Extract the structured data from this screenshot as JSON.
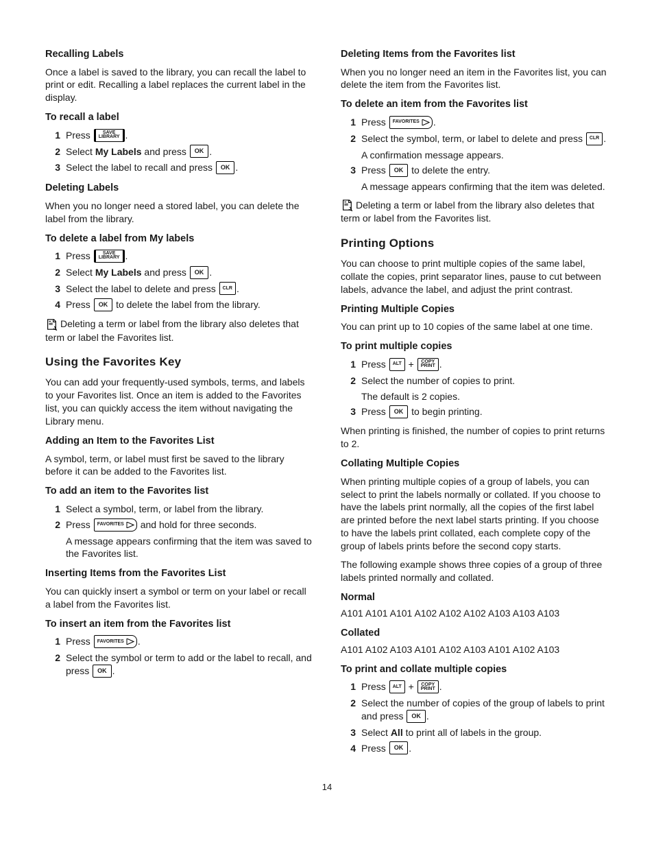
{
  "keys": {
    "save_library": "SAVE\nLIBRARY",
    "ok": "OK",
    "clr": "CLR",
    "favorites": "FAVORITES",
    "alt": "ALT",
    "copy_print": "COPY\nPRINT"
  },
  "page_number": "14",
  "left": {
    "recalling": {
      "title": "Recalling Labels",
      "intro": "Once a label is saved to the library, you can recall the label to print or edit. Recalling a label replaces the current label in the display.",
      "procTitle": "To recall a label",
      "s1a": "Press ",
      "s1b": ".",
      "s2a": "Select ",
      "s2b": "My Labels",
      "s2c": " and press ",
      "s2d": ".",
      "s3a": "Select the label to recall and press ",
      "s3b": "."
    },
    "deleting": {
      "title": "Deleting Labels",
      "intro": "When you no longer need a stored label, you can delete the label from the library.",
      "procTitle": "To delete a label from My labels",
      "s1a": "Press ",
      "s1b": ".",
      "s2a": "Select ",
      "s2b": "My Labels",
      "s2c": " and press ",
      "s2d": ".",
      "s3a": "Select the label to delete and press ",
      "s3b": ".",
      "s4a": "Press ",
      "s4b": " to delete the label from the library.",
      "note": "Deleting a term or label from the library also deletes that term or label the Favorites list."
    },
    "usingFav": {
      "title": "Using the Favorites Key",
      "intro": "You can add your frequently-used symbols, terms, and labels to your Favorites list. Once an item is added to the Favorites list, you can quickly access the item without navigating the Library menu."
    },
    "adding": {
      "title": "Adding an Item to the Favorites List",
      "intro": "A symbol, term, or label must first be saved to the library before it can be added to the Favorites list.",
      "procTitle": "To add an item to the Favorites list",
      "s1": "Select a symbol, term, or label from the library.",
      "s2a": "Press ",
      "s2b": " and hold for three seconds.",
      "s2sub": "A message appears confirming that the item was saved to the Favorites list."
    },
    "inserting": {
      "title": "Inserting Items from the Favorites List",
      "intro": "You can quickly insert a symbol or term on your label or recall a label from the Favorites list.",
      "procTitle": "To insert an item from the Favorites list",
      "s1a": "Press ",
      "s1b": ".",
      "s2a": "Select the symbol or term to add or the label to recall, and press ",
      "s2b": "."
    }
  },
  "right": {
    "deletingFav": {
      "title": "Deleting Items from the Favorites list",
      "intro": "When you no longer need an item in the Favorites list, you can delete the item from the Favorites list.",
      "procTitle": "To delete an item from the Favorites list",
      "s1a": "Press ",
      "s1b": ".",
      "s2a": "Select the symbol, term, or label to delete and press ",
      "s2b": ".",
      "s2sub": "A confirmation message appears.",
      "s3a": "Press ",
      "s3b": " to delete the entry.",
      "s3sub": "A message appears confirming that the item was deleted.",
      "note": "Deleting a term or label from the library also deletes that term or label from the Favorites list."
    },
    "printOpts": {
      "title": "Printing Options",
      "intro": "You can choose to print multiple copies of the same label, collate the copies, print separator lines, pause to cut between labels, advance the label, and adjust the print contrast."
    },
    "multiCopies": {
      "title": "Printing Multiple Copies",
      "intro": "You can print up to 10 copies of the same label at one time.",
      "procTitle": "To print multiple copies",
      "s1a": "Press ",
      "s1plus": " + ",
      "s1b": ".",
      "s2": "Select the number of copies to print.",
      "s2sub": "The default is 2 copies.",
      "s3a": "Press ",
      "s3b": " to begin printing.",
      "outro": "When printing is finished, the number of copies to print returns to 2."
    },
    "collate": {
      "title": "Collating Multiple Copies",
      "intro": "When printing multiple copies of a group of labels, you can select to print the labels normally or collated. If you choose to have the labels print normally, all the copies of the first label are printed before the next label starts printing. If you choose to have the labels print collated, each complete copy of the group of labels prints before the second copy starts.",
      "example": "The following example shows three copies of a group of three labels printed normally and collated.",
      "normalTitle": "Normal",
      "normalSeq": "A101 A101 A101 A102 A102 A102 A103 A103 A103",
      "collatedTitle": "Collated",
      "collatedSeq": "A101 A102 A103 A101 A102 A103 A101 A102 A103",
      "procTitle": "To print and collate multiple copies",
      "s1a": "Press ",
      "s1plus": " + ",
      "s1b": ".",
      "s2a": "Select the number of copies of the group of labels to print and press ",
      "s2b": ".",
      "s3a": "Select ",
      "s3b": "All",
      "s3c": " to print all of labels in the group.",
      "s4a": "Press ",
      "s4b": "."
    }
  }
}
